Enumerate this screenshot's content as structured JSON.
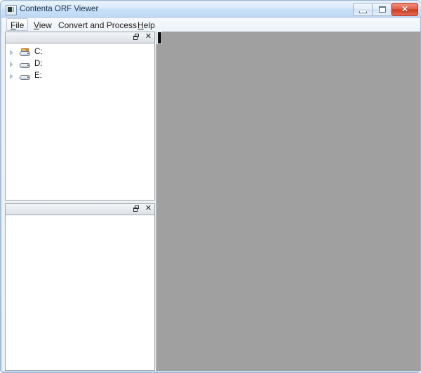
{
  "window": {
    "title": "Contenta ORF Viewer",
    "icon": "app-image-viewer-icon",
    "controls": {
      "minimize_label": "–",
      "maximize_label": "□",
      "close_label": "✕"
    },
    "colors": {
      "titlebar_top": "#eaf3fc",
      "titlebar_bottom": "#bfd9f6",
      "frame_border": "#9cb6d4",
      "close_button": "#cf3a22",
      "canvas_gray": "#a0a0a0",
      "pane_background": "#ffffff",
      "pane_header": "#e6eaee"
    }
  },
  "menubar": {
    "items": [
      {
        "label": "File",
        "mnemonic": "F",
        "active": true
      },
      {
        "label": "View",
        "mnemonic": "V",
        "active": false
      },
      {
        "label": "Convert and Process",
        "mnemonic": "",
        "active": false
      },
      {
        "label": "Help",
        "mnemonic": "H",
        "active": false
      }
    ]
  },
  "panes": {
    "folders": {
      "title": "",
      "float_label": "",
      "close_label": "✕",
      "tree": [
        {
          "label": "C:",
          "icon": "system-drive-icon",
          "expanded": false
        },
        {
          "label": "D:",
          "icon": "drive-icon",
          "expanded": false
        },
        {
          "label": "E:",
          "icon": "drive-icon",
          "expanded": false
        }
      ]
    },
    "files": {
      "title": "",
      "float_label": "",
      "close_label": "✕",
      "items": []
    }
  },
  "canvas": {
    "content": ""
  }
}
